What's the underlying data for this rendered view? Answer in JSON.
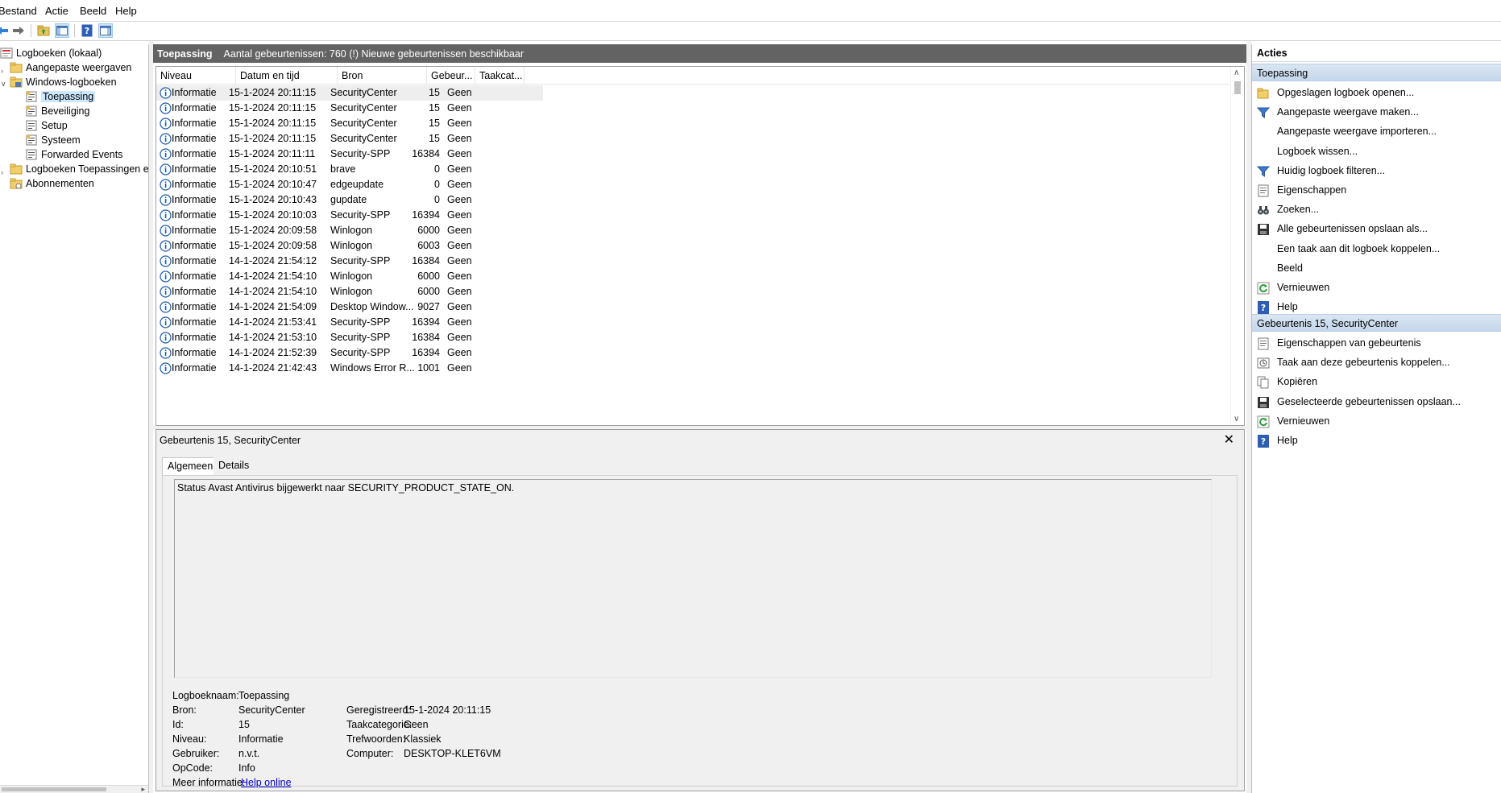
{
  "menu": [
    "Bestand",
    "Actie",
    "Beeld",
    "Help"
  ],
  "toolbar": {
    "icons": [
      "back-arrow-icon",
      "forward-arrow-icon",
      "folder-up-icon",
      "show-hide-tree-icon",
      "help-icon",
      "show-hide-actions-icon"
    ]
  },
  "tree": {
    "items": [
      {
        "label": "Logboeken (lokaal)",
        "icon": "event-viewer-icon"
      },
      {
        "label": "Aangepaste weergaven",
        "icon": "folder-icon"
      },
      {
        "label": "Windows-logboeken",
        "icon": "folder-icon"
      },
      {
        "label": "Toepassing",
        "icon": "log-icon"
      },
      {
        "label": "Beveiliging",
        "icon": "log-icon"
      },
      {
        "label": "Setup",
        "icon": "log-icon"
      },
      {
        "label": "Systeem",
        "icon": "log-icon"
      },
      {
        "label": "Forwarded Events",
        "icon": "log-icon"
      },
      {
        "label": "Logboeken Toepassingen en",
        "icon": "folder-icon"
      },
      {
        "label": "Abonnementen",
        "icon": "subscriptions-icon"
      }
    ]
  },
  "header": {
    "title": "Toepassing",
    "info": "Aantal gebeurtenissen: 760 (!) Nieuwe gebeurtenissen beschikbaar"
  },
  "columns": [
    "Niveau",
    "Datum en tijd",
    "Bron",
    "Gebeur...",
    "Taakcat..."
  ],
  "events": [
    {
      "level": "Informatie",
      "datetime": "15-1-2024 20:11:15",
      "source": "SecurityCenter",
      "id": "15",
      "task": "Geen"
    },
    {
      "level": "Informatie",
      "datetime": "15-1-2024 20:11:15",
      "source": "SecurityCenter",
      "id": "15",
      "task": "Geen"
    },
    {
      "level": "Informatie",
      "datetime": "15-1-2024 20:11:15",
      "source": "SecurityCenter",
      "id": "15",
      "task": "Geen"
    },
    {
      "level": "Informatie",
      "datetime": "15-1-2024 20:11:15",
      "source": "SecurityCenter",
      "id": "15",
      "task": "Geen"
    },
    {
      "level": "Informatie",
      "datetime": "15-1-2024 20:11:11",
      "source": "Security-SPP",
      "id": "16384",
      "task": "Geen"
    },
    {
      "level": "Informatie",
      "datetime": "15-1-2024 20:10:51",
      "source": "brave",
      "id": "0",
      "task": "Geen"
    },
    {
      "level": "Informatie",
      "datetime": "15-1-2024 20:10:47",
      "source": "edgeupdate",
      "id": "0",
      "task": "Geen"
    },
    {
      "level": "Informatie",
      "datetime": "15-1-2024 20:10:43",
      "source": "gupdate",
      "id": "0",
      "task": "Geen"
    },
    {
      "level": "Informatie",
      "datetime": "15-1-2024 20:10:03",
      "source": "Security-SPP",
      "id": "16394",
      "task": "Geen"
    },
    {
      "level": "Informatie",
      "datetime": "15-1-2024 20:09:58",
      "source": "Winlogon",
      "id": "6000",
      "task": "Geen"
    },
    {
      "level": "Informatie",
      "datetime": "15-1-2024 20:09:58",
      "source": "Winlogon",
      "id": "6003",
      "task": "Geen"
    },
    {
      "level": "Informatie",
      "datetime": "14-1-2024 21:54:12",
      "source": "Security-SPP",
      "id": "16384",
      "task": "Geen"
    },
    {
      "level": "Informatie",
      "datetime": "14-1-2024 21:54:10",
      "source": "Winlogon",
      "id": "6000",
      "task": "Geen"
    },
    {
      "level": "Informatie",
      "datetime": "14-1-2024 21:54:10",
      "source": "Winlogon",
      "id": "6000",
      "task": "Geen"
    },
    {
      "level": "Informatie",
      "datetime": "14-1-2024 21:54:09",
      "source": "Desktop Window...",
      "id": "9027",
      "task": "Geen"
    },
    {
      "level": "Informatie",
      "datetime": "14-1-2024 21:53:41",
      "source": "Security-SPP",
      "id": "16394",
      "task": "Geen"
    },
    {
      "level": "Informatie",
      "datetime": "14-1-2024 21:53:10",
      "source": "Security-SPP",
      "id": "16384",
      "task": "Geen"
    },
    {
      "level": "Informatie",
      "datetime": "14-1-2024 21:52:39",
      "source": "Security-SPP",
      "id": "16394",
      "task": "Geen"
    },
    {
      "level": "Informatie",
      "datetime": "14-1-2024 21:42:43",
      "source": "Windows Error R...",
      "id": "1001",
      "task": "Geen"
    }
  ],
  "detail": {
    "title": "Gebeurtenis 15, SecurityCenter",
    "tabs": [
      "Algemeen",
      "Details"
    ],
    "message": "Status Avast Antivirus bijgewerkt naar SECURITY_PRODUCT_STATE_ON.",
    "labels": {
      "logname": "Logboeknaam:",
      "source": "Bron:",
      "id": "Id:",
      "level": "Niveau:",
      "user": "Gebruiker:",
      "opcode": "OpCode:",
      "moreinfo": "Meer informatie:",
      "logged": "Geregistreerd:",
      "task": "Taakcategorie:",
      "keywords": "Trefwoorden:",
      "computer": "Computer:"
    },
    "values": {
      "logname": "Toepassing",
      "source": "SecurityCenter",
      "id": "15",
      "level": "Informatie",
      "user": "n.v.t.",
      "opcode": "Info",
      "moreinfo": "Help online",
      "logged": "15-1-2024 20:11:15",
      "task": "Geen",
      "keywords": "Klassiek",
      "computer": "DESKTOP-KLET6VM"
    }
  },
  "actions": {
    "header": "Acties",
    "section1": "Toepassing",
    "items1": [
      {
        "label": "Opgeslagen logboek openen...",
        "icon": "open-folder-icon"
      },
      {
        "label": "Aangepaste weergave maken...",
        "icon": "filter-icon"
      },
      {
        "label": "Aangepaste weergave importeren...",
        "icon": ""
      },
      {
        "label": "Logboek wissen...",
        "icon": ""
      },
      {
        "label": "Huidig logboek filteren...",
        "icon": "filter-icon"
      },
      {
        "label": "Eigenschappen",
        "icon": "properties-icon"
      },
      {
        "label": "Zoeken...",
        "icon": "binoculars-icon"
      },
      {
        "label": "Alle gebeurtenissen opslaan als...",
        "icon": "save-icon"
      },
      {
        "label": "Een taak aan dit logboek koppelen...",
        "icon": ""
      },
      {
        "label": "Beeld",
        "icon": ""
      },
      {
        "label": "Vernieuwen",
        "icon": "refresh-icon"
      },
      {
        "label": "Help",
        "icon": "help-icon"
      }
    ],
    "section2": "Gebeurtenis 15, SecurityCenter",
    "items2": [
      {
        "label": "Eigenschappen van gebeurtenis",
        "icon": "properties-icon"
      },
      {
        "label": "Taak aan deze gebeurtenis koppelen...",
        "icon": "task-icon"
      },
      {
        "label": "Kopiëren",
        "icon": "copy-icon"
      },
      {
        "label": "Geselecteerde gebeurtenissen opslaan...",
        "icon": "save-icon"
      },
      {
        "label": "Vernieuwen",
        "icon": "refresh-icon"
      },
      {
        "label": "Help",
        "icon": "help-icon"
      }
    ]
  },
  "colors": {
    "header_bg": "#636363",
    "section_bg": "#c9d9eb",
    "selection": "#cce8ff",
    "link": "#0000cc",
    "info_icon": "#1e5aa8"
  }
}
